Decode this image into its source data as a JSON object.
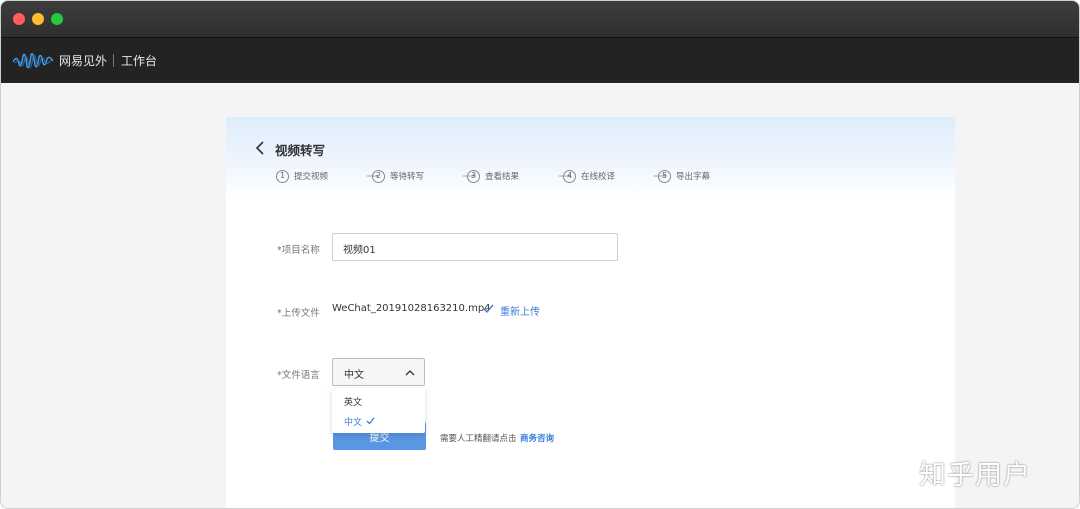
{
  "app": {
    "brand": "网易见外",
    "workspace": "工作台"
  },
  "page": {
    "title": "视频转写"
  },
  "steps": [
    {
      "num": "1",
      "label": "提交视频"
    },
    {
      "num": "2",
      "label": "等待转写"
    },
    {
      "num": "3",
      "label": "查看结果"
    },
    {
      "num": "4",
      "label": "在线校译"
    },
    {
      "num": "5",
      "label": "导出字幕"
    }
  ],
  "form": {
    "project_name": {
      "label": "*项目名称",
      "value": "视频01"
    },
    "upload_file": {
      "label": "*上传文件",
      "filename": "WeChat_20191028163210.mp4",
      "reupload": "重新上传"
    },
    "language": {
      "label": "*文件语言",
      "selected": "中文",
      "options": [
        "英文",
        "中文"
      ]
    },
    "submit_label": "提交",
    "hint": "需要人工精翻请点击",
    "hint_link": "商务咨询"
  },
  "watermark": "知乎用户",
  "colors": {
    "accent": "#3a7dd8",
    "button": "#5a96e3",
    "titlebar": "#2f2f2f",
    "appbar": "#232323"
  }
}
